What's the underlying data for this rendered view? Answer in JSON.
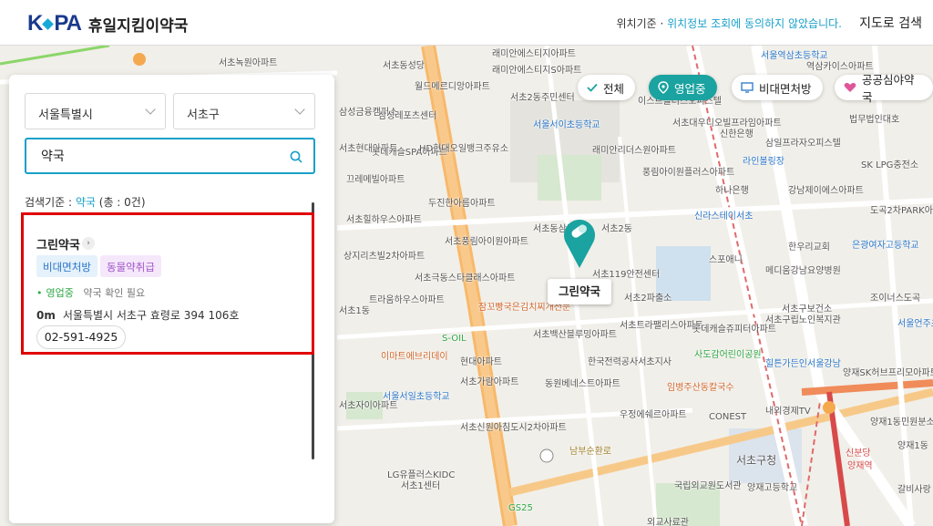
{
  "app": {
    "logo_text": "KPA",
    "title": "휴일지킴이약국"
  },
  "header": {
    "location_prefix": "위치기준 · ",
    "location_notice": "위치정보 조회에 동의하지 않았습니다.",
    "map_search": "지도로 검색"
  },
  "filters": {
    "city": "서울특별시",
    "district": "서초구",
    "search_value": "약국",
    "criteria_label": "검색기준 : ",
    "criteria_keyword": "약국",
    "criteria_count": "(총 : 0건)"
  },
  "chips": [
    {
      "label": "전체",
      "icon": "check-icon"
    },
    {
      "label": "영업중",
      "icon": "location-pin-icon",
      "active": true
    },
    {
      "label": "비대면처방",
      "icon": "monitor-icon"
    },
    {
      "label": "공공심야약국",
      "icon": "heart-icon"
    }
  ],
  "pharmacy": {
    "name": "그린약국",
    "tags": [
      "비대면처방",
      "동물약취급"
    ],
    "status_open": "영업중",
    "status_note": "약국 확인 필요",
    "distance": "0m",
    "address": "서울특별시 서초구 효령로 394 106호",
    "phone": "02-591-4925"
  },
  "map": {
    "marker_label": "그린약국",
    "labels": [
      "서초녹원아파트",
      "서초동성당",
      "월드메르디앙아파트",
      "래미안에스티지아파트",
      "래미안에스티지S아파트",
      "서초2동주민센터",
      "서울서이초등학교",
      "삼성금융캠퍼스",
      "삼성레포츠센터",
      "서초현대아파트",
      "롯데캐슬SPA아파트",
      "HD현대오일뱅크주유소",
      "래미안리더스원아파트",
      "풍림아이원플러스아파트",
      "끄레메빌아파트",
      "두진한아름아파트",
      "서초힐하우스아파트",
      "서초풍림아이원아파트",
      "상지리츠빌2차아파트",
      "서초동삼풍",
      "서초2동",
      "서초119안전센터",
      "서초2파출소",
      "서초극동스타클래스아파트",
      "트라움하우스아파트",
      "잠꼬빵국은김치찌개전문",
      "서초백산블루밍아파트",
      "서초트라팰리스아파트",
      "롯데캐슬쥬피터아파트",
      "S-OIL",
      "현대아파트",
      "한국전력공사서초지사",
      "이마트에브리데이",
      "서초가람아파트",
      "동원베네스트아파트",
      "서울서일초등학교",
      "서초자이아파트",
      "서초신원아침도시2차아파트",
      "우정에쉐르아파트",
      "CONEST",
      "서초구청",
      "국립외교원도서관",
      "양재고등학교",
      "LG유플러스KIDC",
      "서초1센터",
      "GS25",
      "외교사료관",
      "남부순환로",
      "서울역삼초등학교",
      "역삼카이스아파트",
      "이스트플러스오피스텔",
      "서초대우디오빌프라임아파트",
      "신한은행",
      "삼일프라자오피스텔",
      "라인볼링장",
      "하나은행",
      "강남제이에스아파트",
      "신라스테이서초",
      "한우리교회",
      "메디움강남요양병원",
      "서초구보건소",
      "서초구립노인복지관",
      "은광여자고등학교",
      "도곡2차PARK아파트",
      "SK LPG충전소",
      "법무법인대호",
      "스포애니",
      "사도감어린이공원",
      "힐튼가든인서울강남",
      "임병주산동칼국수",
      "내외경제TV",
      "양재SK허브프리모아파트",
      "양재1동민원분소",
      "신분당",
      "양재역",
      "갈비사랑",
      "조이너스도곡",
      "서초1동",
      "양재1동",
      "서울언주초등학교"
    ]
  }
}
